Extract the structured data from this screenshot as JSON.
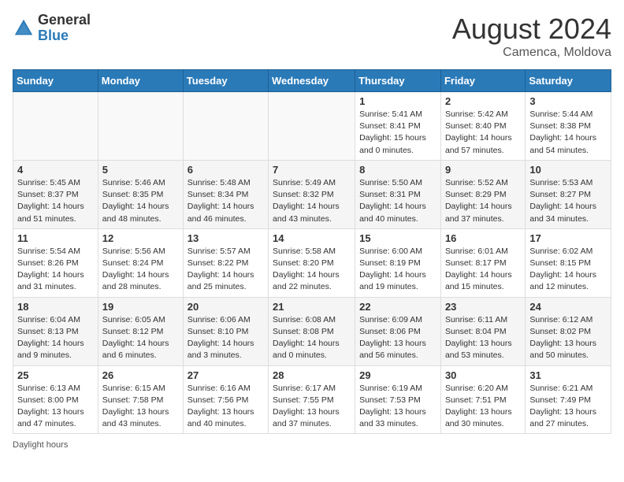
{
  "header": {
    "logo_general": "General",
    "logo_blue": "Blue",
    "month_year": "August 2024",
    "location": "Camenca, Moldova"
  },
  "days_of_week": [
    "Sunday",
    "Monday",
    "Tuesday",
    "Wednesday",
    "Thursday",
    "Friday",
    "Saturday"
  ],
  "weeks": [
    [
      {
        "day": "",
        "info": ""
      },
      {
        "day": "",
        "info": ""
      },
      {
        "day": "",
        "info": ""
      },
      {
        "day": "",
        "info": ""
      },
      {
        "day": "1",
        "info": "Sunrise: 5:41 AM\nSunset: 8:41 PM\nDaylight: 15 hours\nand 0 minutes."
      },
      {
        "day": "2",
        "info": "Sunrise: 5:42 AM\nSunset: 8:40 PM\nDaylight: 14 hours\nand 57 minutes."
      },
      {
        "day": "3",
        "info": "Sunrise: 5:44 AM\nSunset: 8:38 PM\nDaylight: 14 hours\nand 54 minutes."
      }
    ],
    [
      {
        "day": "4",
        "info": "Sunrise: 5:45 AM\nSunset: 8:37 PM\nDaylight: 14 hours\nand 51 minutes."
      },
      {
        "day": "5",
        "info": "Sunrise: 5:46 AM\nSunset: 8:35 PM\nDaylight: 14 hours\nand 48 minutes."
      },
      {
        "day": "6",
        "info": "Sunrise: 5:48 AM\nSunset: 8:34 PM\nDaylight: 14 hours\nand 46 minutes."
      },
      {
        "day": "7",
        "info": "Sunrise: 5:49 AM\nSunset: 8:32 PM\nDaylight: 14 hours\nand 43 minutes."
      },
      {
        "day": "8",
        "info": "Sunrise: 5:50 AM\nSunset: 8:31 PM\nDaylight: 14 hours\nand 40 minutes."
      },
      {
        "day": "9",
        "info": "Sunrise: 5:52 AM\nSunset: 8:29 PM\nDaylight: 14 hours\nand 37 minutes."
      },
      {
        "day": "10",
        "info": "Sunrise: 5:53 AM\nSunset: 8:27 PM\nDaylight: 14 hours\nand 34 minutes."
      }
    ],
    [
      {
        "day": "11",
        "info": "Sunrise: 5:54 AM\nSunset: 8:26 PM\nDaylight: 14 hours\nand 31 minutes."
      },
      {
        "day": "12",
        "info": "Sunrise: 5:56 AM\nSunset: 8:24 PM\nDaylight: 14 hours\nand 28 minutes."
      },
      {
        "day": "13",
        "info": "Sunrise: 5:57 AM\nSunset: 8:22 PM\nDaylight: 14 hours\nand 25 minutes."
      },
      {
        "day": "14",
        "info": "Sunrise: 5:58 AM\nSunset: 8:20 PM\nDaylight: 14 hours\nand 22 minutes."
      },
      {
        "day": "15",
        "info": "Sunrise: 6:00 AM\nSunset: 8:19 PM\nDaylight: 14 hours\nand 19 minutes."
      },
      {
        "day": "16",
        "info": "Sunrise: 6:01 AM\nSunset: 8:17 PM\nDaylight: 14 hours\nand 15 minutes."
      },
      {
        "day": "17",
        "info": "Sunrise: 6:02 AM\nSunset: 8:15 PM\nDaylight: 14 hours\nand 12 minutes."
      }
    ],
    [
      {
        "day": "18",
        "info": "Sunrise: 6:04 AM\nSunset: 8:13 PM\nDaylight: 14 hours\nand 9 minutes."
      },
      {
        "day": "19",
        "info": "Sunrise: 6:05 AM\nSunset: 8:12 PM\nDaylight: 14 hours\nand 6 minutes."
      },
      {
        "day": "20",
        "info": "Sunrise: 6:06 AM\nSunset: 8:10 PM\nDaylight: 14 hours\nand 3 minutes."
      },
      {
        "day": "21",
        "info": "Sunrise: 6:08 AM\nSunset: 8:08 PM\nDaylight: 14 hours\nand 0 minutes."
      },
      {
        "day": "22",
        "info": "Sunrise: 6:09 AM\nSunset: 8:06 PM\nDaylight: 13 hours\nand 56 minutes."
      },
      {
        "day": "23",
        "info": "Sunrise: 6:11 AM\nSunset: 8:04 PM\nDaylight: 13 hours\nand 53 minutes."
      },
      {
        "day": "24",
        "info": "Sunrise: 6:12 AM\nSunset: 8:02 PM\nDaylight: 13 hours\nand 50 minutes."
      }
    ],
    [
      {
        "day": "25",
        "info": "Sunrise: 6:13 AM\nSunset: 8:00 PM\nDaylight: 13 hours\nand 47 minutes."
      },
      {
        "day": "26",
        "info": "Sunrise: 6:15 AM\nSunset: 7:58 PM\nDaylight: 13 hours\nand 43 minutes."
      },
      {
        "day": "27",
        "info": "Sunrise: 6:16 AM\nSunset: 7:56 PM\nDaylight: 13 hours\nand 40 minutes."
      },
      {
        "day": "28",
        "info": "Sunrise: 6:17 AM\nSunset: 7:55 PM\nDaylight: 13 hours\nand 37 minutes."
      },
      {
        "day": "29",
        "info": "Sunrise: 6:19 AM\nSunset: 7:53 PM\nDaylight: 13 hours\nand 33 minutes."
      },
      {
        "day": "30",
        "info": "Sunrise: 6:20 AM\nSunset: 7:51 PM\nDaylight: 13 hours\nand 30 minutes."
      },
      {
        "day": "31",
        "info": "Sunrise: 6:21 AM\nSunset: 7:49 PM\nDaylight: 13 hours\nand 27 minutes."
      }
    ]
  ],
  "footer": {
    "note": "Daylight hours"
  }
}
